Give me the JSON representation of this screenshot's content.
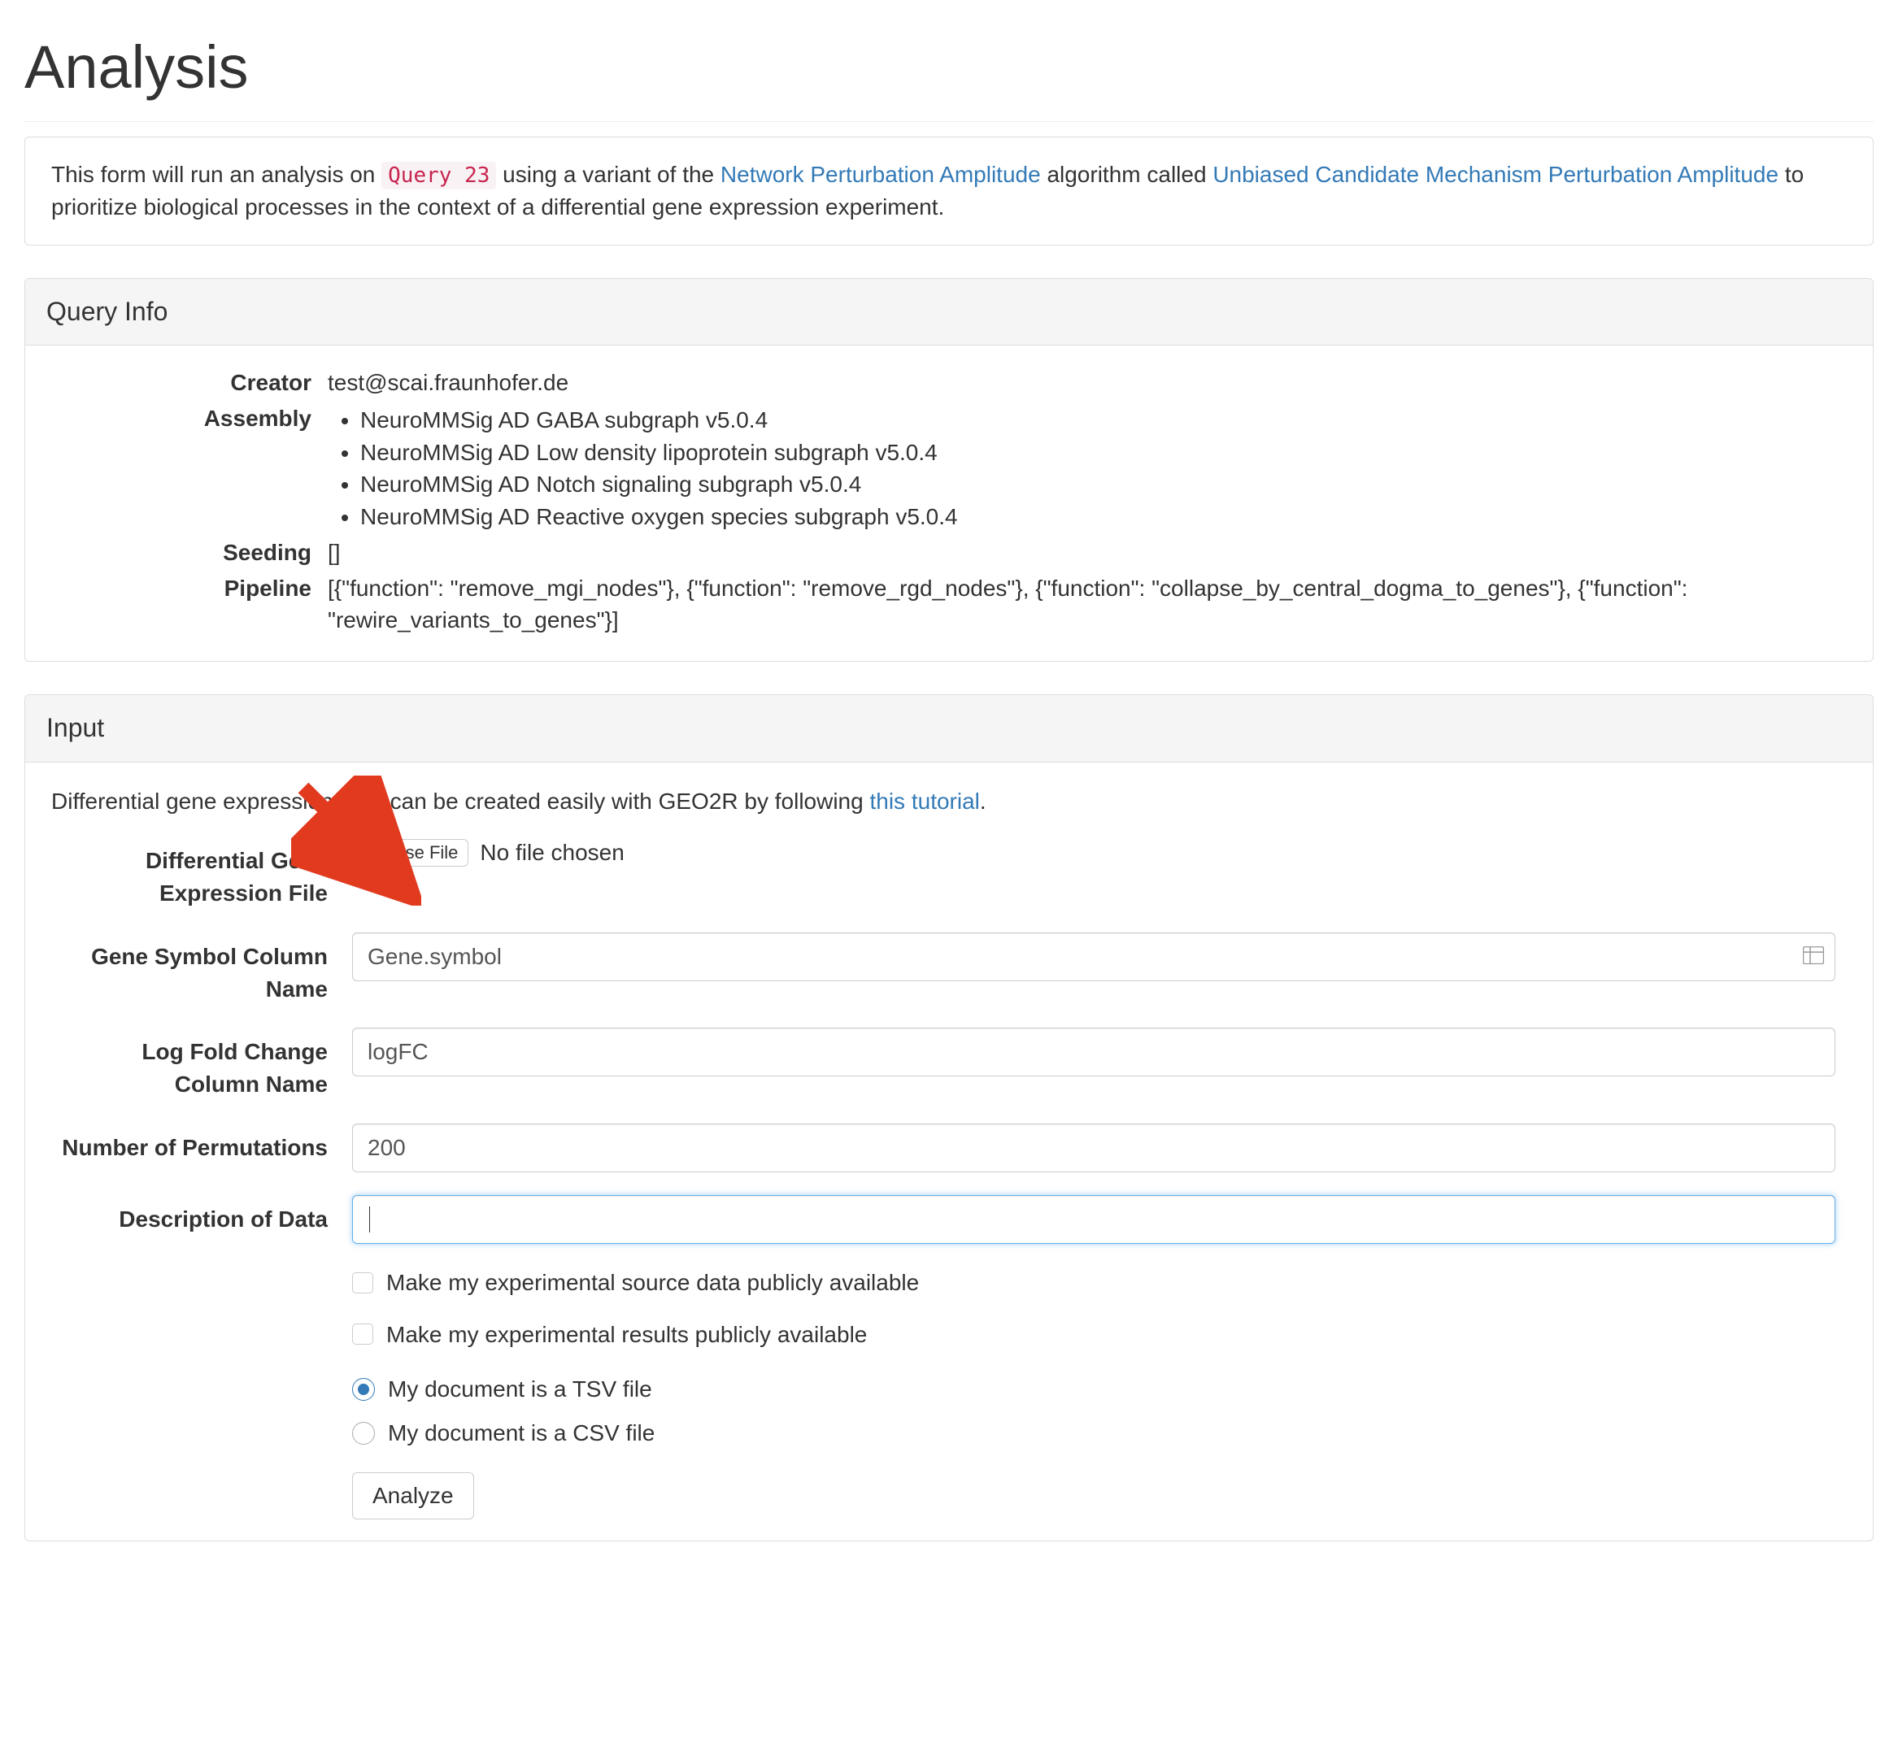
{
  "page_title": "Analysis",
  "intro": {
    "prefix": "This form will run an analysis on ",
    "query_code": "Query 23",
    "mid1": " using a variant of the ",
    "link1_text": "Network Perturbation Amplitude",
    "mid2": " algorithm called ",
    "link2_text": "Unbiased Candidate Mechanism Perturbation Amplitude",
    "suffix": " to prioritize biological processes in the context of a differential gene expression experiment."
  },
  "query_info": {
    "heading": "Query Info",
    "labels": {
      "creator": "Creator",
      "assembly": "Assembly",
      "seeding": "Seeding",
      "pipeline": "Pipeline"
    },
    "creator_value": "test@scai.fraunhofer.de",
    "assembly_items": [
      "NeuroMMSig AD GABA subgraph v5.0.4",
      "NeuroMMSig AD Low density lipoprotein subgraph v5.0.4",
      "NeuroMMSig AD Notch signaling subgraph v5.0.4",
      "NeuroMMSig AD Reactive oxygen species subgraph v5.0.4"
    ],
    "seeding_value": "[]",
    "pipeline_value": "[{\"function\": \"remove_mgi_nodes\"}, {\"function\": \"remove_rgd_nodes\"}, {\"function\": \"collapse_by_central_dogma_to_genes\"}, {\"function\": \"rewire_variants_to_genes\"}]"
  },
  "input": {
    "heading": "Input",
    "note_prefix": "Differential gene expression data can be created easily with GEO2R by following ",
    "note_link": "this tutorial",
    "note_suffix": ".",
    "file_label": "Differential Gene Expression File",
    "choose_file_btn": "Choose File",
    "no_file_text": "No file chosen",
    "gene_symbol": {
      "label": "Gene Symbol Column Name",
      "value": "Gene.symbol"
    },
    "logfc": {
      "label": "Log Fold Change Column Name",
      "value": "logFC"
    },
    "permutations": {
      "label": "Number of Permutations",
      "value": "200"
    },
    "description": {
      "label": "Description of Data",
      "value": ""
    },
    "checkboxes": [
      "Make my experimental source data publicly available",
      "Make my experimental results publicly available"
    ],
    "radios": [
      {
        "label": "My document is a TSV file",
        "checked": true
      },
      {
        "label": "My document is a CSV file",
        "checked": false
      }
    ],
    "analyze_btn": "Analyze"
  }
}
